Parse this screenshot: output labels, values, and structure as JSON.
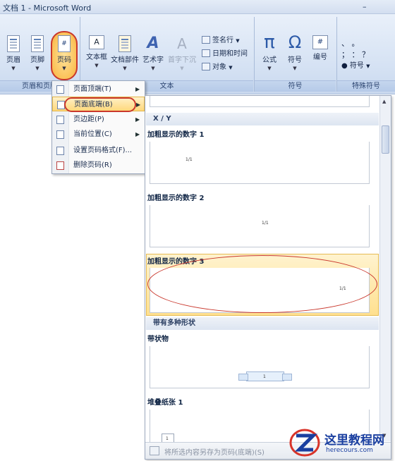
{
  "window": {
    "title": "文档 1 - Microsoft Word",
    "minimize_glyph": "–"
  },
  "ribbon": {
    "groups": [
      {
        "label": "页眉和页脚"
      },
      {
        "label": "文本"
      },
      {
        "label": "符号"
      },
      {
        "label": "特殊符号"
      }
    ],
    "header_footer": {
      "header_label": "页眉",
      "footer_label": "页脚",
      "page_number_label": "页码"
    },
    "text": {
      "textbox_label": "文本框",
      "quickparts_label": "文档部件",
      "wordart_label": "艺术字",
      "dropcap_label": "首字下沉",
      "signature_line": "签名行",
      "date_time": "日期和时间",
      "object": "对象"
    },
    "symbols": {
      "equation_label": "公式",
      "symbol_label": "符号",
      "number_label": "编号",
      "pi_glyph": "π",
      "omega_glyph": "Ω",
      "hash_glyph": "#"
    },
    "special": {
      "row1": "、  。",
      "row2": "；  ：  ？",
      "more_label": "符号"
    }
  },
  "dropdown_menu": {
    "items": [
      {
        "label": "页面顶端(T)",
        "has_submenu": true
      },
      {
        "label": "页面底端(B)",
        "has_submenu": true,
        "selected": true
      },
      {
        "label": "页边距(P)",
        "has_submenu": true
      },
      {
        "label": "当前位置(C)",
        "has_submenu": true
      },
      {
        "label": "设置页码格式(F)...",
        "has_submenu": false
      },
      {
        "label": "删除页码(R)",
        "has_submenu": false
      }
    ]
  },
  "gallery": {
    "categories": [
      {
        "label": "X / Y"
      },
      {
        "label": "带有多种形状"
      }
    ],
    "items": [
      {
        "name": "加粗显示的数字 1",
        "preview": "1/1"
      },
      {
        "name": "加粗显示的数字 2",
        "preview": "1/1"
      },
      {
        "name": "加粗显示的数字 3",
        "preview": "1/1"
      },
      {
        "name": "带状物",
        "preview": "1"
      },
      {
        "name": "堆叠纸张 1",
        "preview": "1"
      }
    ],
    "footer_label": "将所选内容另存为页码(底端)(S)"
  },
  "watermark": {
    "title": "这里教程网",
    "url": "herecours.com"
  }
}
